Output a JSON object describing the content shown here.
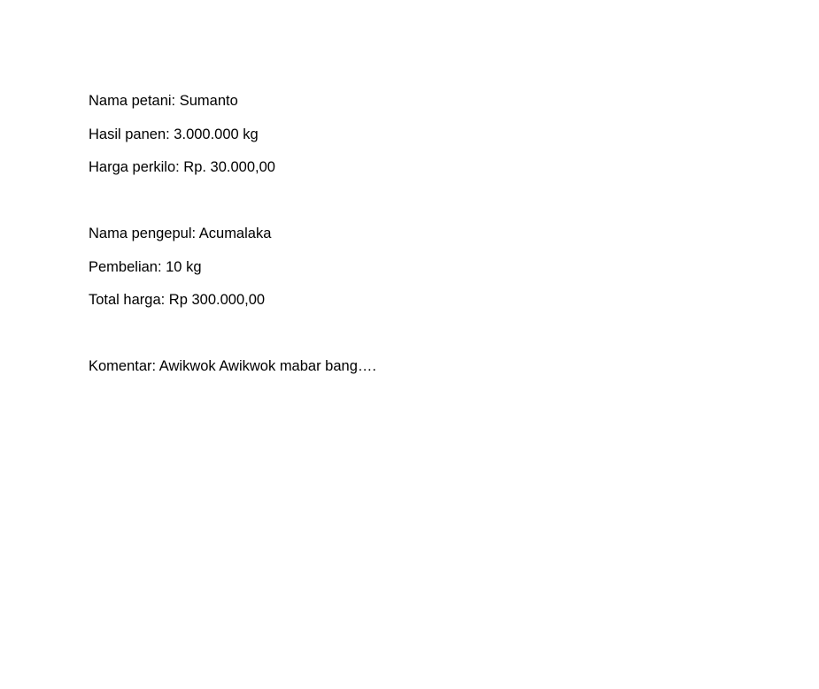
{
  "petani": {
    "nama": "Nama petani: Sumanto",
    "hasil_panen": "Hasil panen: 3.000.000 kg",
    "harga_perkilo": "Harga perkilo: Rp. 30.000,00"
  },
  "pengepul": {
    "nama": "Nama pengepul: Acumalaka",
    "pembelian": "Pembelian: 10 kg",
    "total_harga": "Total harga: Rp 300.000,00"
  },
  "komentar": "Komentar: Awikwok Awikwok mabar bang…."
}
